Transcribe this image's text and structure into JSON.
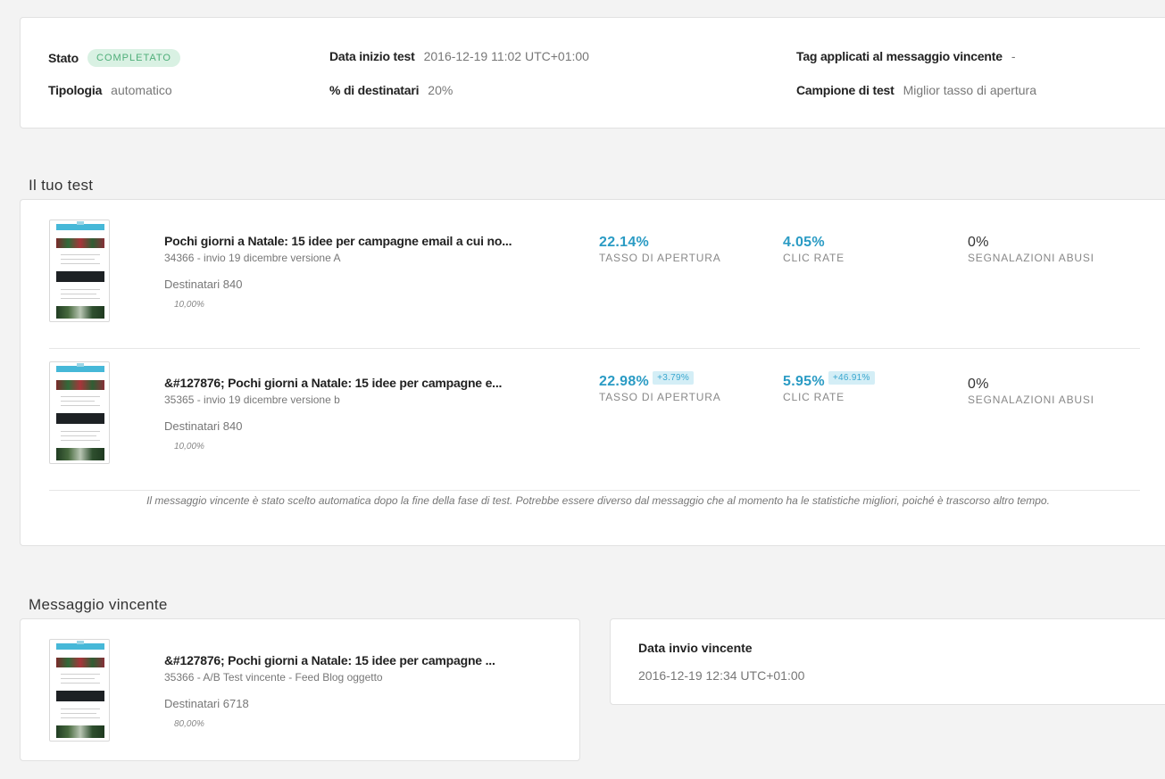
{
  "summary": {
    "status_label": "Stato",
    "status_badge": "COMPLETATO",
    "type_label": "Tipologia",
    "type_value": "automatico",
    "start_label": "Data inizio test",
    "start_value": "2016-12-19 11:02 UTC+01:00",
    "recipients_label": "% di destinatari",
    "recipients_value": "20%",
    "tags_label": "Tag applicati al messaggio vincente",
    "tags_value": "-",
    "sample_label": "Campione di test",
    "sample_value": "Miglior tasso di apertura"
  },
  "test_section": {
    "title": "Il tuo test",
    "messages": [
      {
        "title": "Pochi giorni a Natale: 15 idee per campagne email a cui no...",
        "subtitle": "34366 - invio 19 dicembre versione A",
        "recipients": "Destinatari 840",
        "percent": "10,00%",
        "open_rate": "22.14%",
        "open_label": "TASSO DI APERTURA",
        "click_rate": "4.05%",
        "click_label": "CLIC RATE",
        "abuse": "0%",
        "abuse_label": "SEGNALAZIONI ABUSI"
      },
      {
        "title": "&#127876; Pochi giorni a Natale: 15 idee per campagne e...",
        "subtitle": "35365 - invio 19 dicembre versione b",
        "recipients": "Destinatari 840",
        "percent": "10,00%",
        "open_rate": "22.98%",
        "open_delta": "+3.79%",
        "open_label": "TASSO DI APERTURA",
        "click_rate": "5.95%",
        "click_delta": "+46.91%",
        "click_label": "CLIC RATE",
        "abuse": "0%",
        "abuse_label": "SEGNALAZIONI ABUSI"
      }
    ],
    "note": "Il messaggio vincente è stato scelto automatica dopo la fine della fase di test. Potrebbe essere diverso dal messaggio che al momento ha le statistiche migliori, poiché è trascorso altro tempo."
  },
  "winner_section": {
    "title": "Messaggio vincente",
    "message": {
      "title": "&#127876; Pochi giorni a Natale: 15 idee per campagne ...",
      "subtitle": "35366 - A/B Test vincente - Feed Blog oggetto",
      "recipients": "Destinatari 6718",
      "percent": "80,00%"
    },
    "date_label": "Data invio vincente",
    "date_value": "2016-12-19 12:34 UTC+01:00"
  },
  "colors": {
    "accent": "#2a9bc4",
    "badge_bg": "#d9f1e3",
    "badge_text": "#4fae79",
    "delta_bg": "#d4eef6"
  },
  "icons": [
    "email-thumbnail"
  ]
}
